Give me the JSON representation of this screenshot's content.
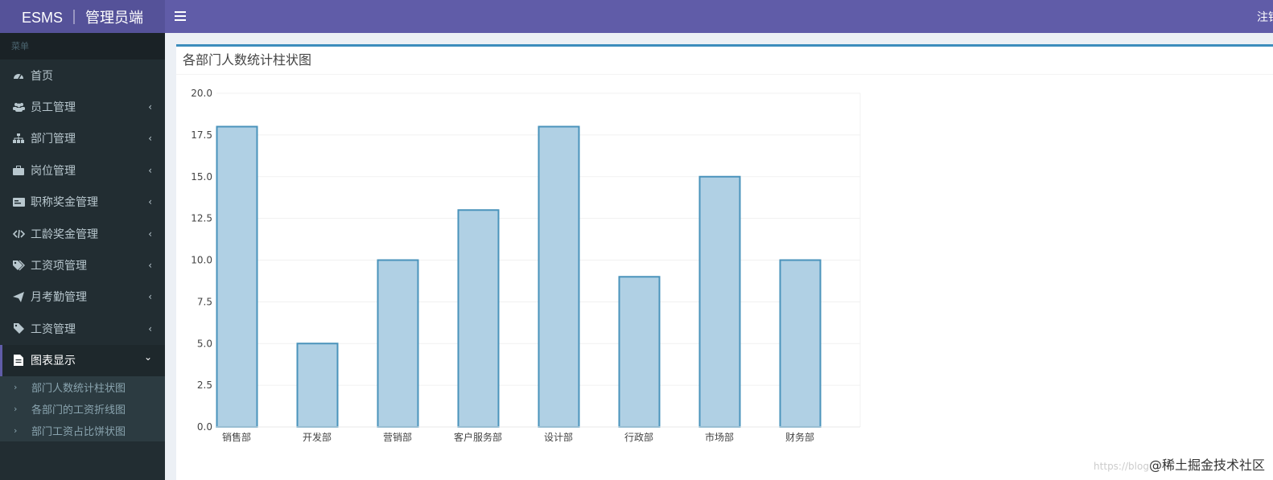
{
  "header": {
    "brand": "ESMS ｜ 管理员端",
    "logout": "注销"
  },
  "sidebar": {
    "menu_header": "菜单",
    "items": [
      {
        "label": "首页",
        "icon": "dashboard-icon",
        "chevron": ""
      },
      {
        "label": "员工管理",
        "icon": "users-icon",
        "chevron": "‹"
      },
      {
        "label": "部门管理",
        "icon": "sitemap-icon",
        "chevron": "‹"
      },
      {
        "label": "岗位管理",
        "icon": "briefcase-icon",
        "chevron": "‹"
      },
      {
        "label": "职称奖金管理",
        "icon": "id-card-icon",
        "chevron": "‹"
      },
      {
        "label": "工龄奖金管理",
        "icon": "code-icon",
        "chevron": "‹"
      },
      {
        "label": "工资项管理",
        "icon": "tags-icon",
        "chevron": "‹"
      },
      {
        "label": "月考勤管理",
        "icon": "paper-plane-icon",
        "chevron": "‹"
      },
      {
        "label": "工资管理",
        "icon": "tag-icon",
        "chevron": "‹"
      },
      {
        "label": "图表显示",
        "icon": "file-icon",
        "chevron": "⌄"
      }
    ],
    "subitems": [
      {
        "label": "部门人数统计柱状图"
      },
      {
        "label": "各部门的工资折线图"
      },
      {
        "label": "部门工资占比饼状图"
      }
    ]
  },
  "main": {
    "title": "各部门人数统计柱状图"
  },
  "chart_data": {
    "type": "bar",
    "categories": [
      "销售部",
      "开发部",
      "营销部",
      "客户服务部",
      "设计部",
      "行政部",
      "市场部",
      "财务部"
    ],
    "values": [
      18,
      5,
      10,
      13,
      18,
      9,
      15,
      10
    ],
    "ylim": [
      0,
      20
    ],
    "yticks": [
      "0.0",
      "2.5",
      "5.0",
      "7.5",
      "10.0",
      "12.5",
      "15.0",
      "17.5",
      "20.0"
    ],
    "grid": true,
    "colors": {
      "fill": "#b0d0e4",
      "stroke": "#4a93bb"
    }
  },
  "watermark": {
    "url": "https://blog",
    "text": "@稀土掘金技术社区"
  }
}
